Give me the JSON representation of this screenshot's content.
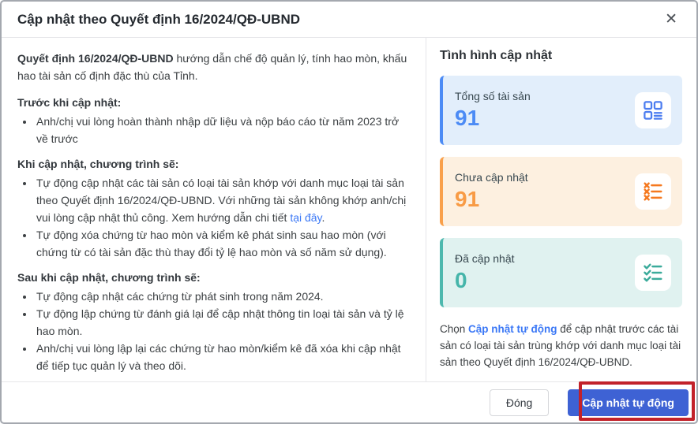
{
  "dialog": {
    "title": "Cập nhật theo Quyết định 16/2024/QĐ-UBND",
    "close_glyph": "✕"
  },
  "content": {
    "intro_bold": "Quyết định 16/2024/QĐ-UBND",
    "intro_rest": " hướng dẫn chế độ quản lý, tính hao mòn, khấu hao tài sản cố định đặc thù của Tỉnh.",
    "before": {
      "heading": "Trước khi cập nhật:",
      "items": [
        "Anh/chị vui lòng hoàn thành nhập dữ liệu và nộp báo cáo từ năm 2023 trở về trước"
      ]
    },
    "during": {
      "heading": "Khi cập nhật, chương trình sẽ:",
      "item1_before_link": "Tự động cập nhật các tài sản có loại tài sản khớp với danh mục loại tài sản theo Quyết định 16/2024/QĐ-UBND. Với những tài sản không khớp anh/chị vui lòng cập nhật thủ công. Xem hướng dẫn chi tiết ",
      "item1_link": "tại đây",
      "item1_after_link": ".",
      "item2": "Tự động xóa chứng từ hao mòn và kiểm kê phát sinh sau hao mòn (với chứng từ có tài sản đặc thù thay đổi tỷ lệ hao mòn và số năm sử dụng)."
    },
    "after": {
      "heading": "Sau khi cập nhật, chương trình sẽ:",
      "items": [
        "Tự động cập nhật các chứng từ phát sinh trong năm 2024.",
        "Tự động lập chứng từ đánh giá lại để cập nhật thông tin loại tài sản và tỷ lệ hao mòn.",
        "Anh/chị vui lòng lập lại các chứng từ hao mòn/kiểm kê đã xóa khi cập nhật để tiếp tục quản lý và theo dõi."
      ]
    }
  },
  "status_panel": {
    "title": "Tình hình cập nhật",
    "cards": [
      {
        "label": "Tổng số tài sản",
        "value": "91",
        "icon": "grid-list-icon",
        "accent": "#4c8bf5",
        "bg": "#e2eefb"
      },
      {
        "label": "Chưa cập nhật",
        "value": "91",
        "icon": "x-list-icon",
        "accent": "#f9a04b",
        "bg": "#fdf0e0"
      },
      {
        "label": "Đã cập nhật",
        "value": "0",
        "icon": "check-list-icon",
        "accent": "#4db8ae",
        "bg": "#e0f2f0"
      }
    ],
    "note_before_link": "Chọn ",
    "note_link": "Cập nhật tự động",
    "note_after_link": " để cập nhật trước các tài sản có loại tài sản trùng khớp với danh mục loại tài sản theo Quyết định 16/2024/QĐ-UBND."
  },
  "footer": {
    "close_label": "Đóng",
    "primary_label": "Cập nhật tự động"
  },
  "annotation": {
    "highlight_color": "#c2222a"
  }
}
